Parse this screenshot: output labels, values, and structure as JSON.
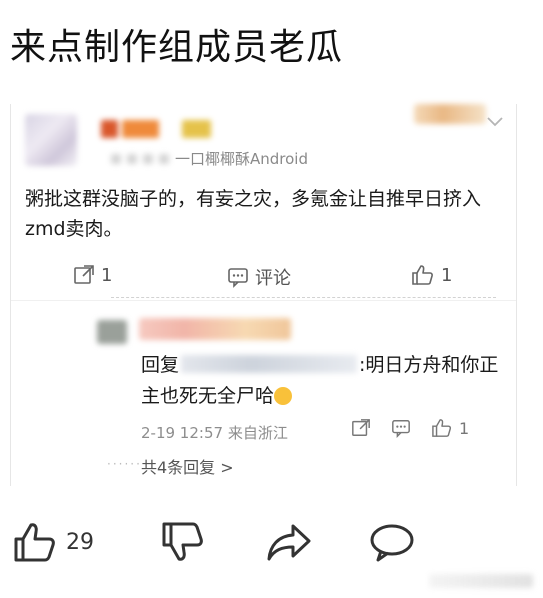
{
  "headline": "来点制作组成员老瓜",
  "post": {
    "source": "一口椰椰酥Android",
    "text": "粥批这群没脑子的，有妄之灾，多氪金让自推早日挤入zmd卖肉。",
    "repost_count": "1",
    "comment_label": "评论",
    "like_count": "1"
  },
  "reply": {
    "prefix": "回复",
    "suffix": ":明日方舟和你正主也死无全尸哈",
    "timestamp": "2-19 12:57",
    "location": "来自浙江",
    "like_count": "1",
    "more_replies": "共4条回复 >"
  },
  "bottom": {
    "like_count": "29"
  },
  "colors": {
    "text": "#1a1a1a",
    "meta": "#8a8a8a",
    "icon": "#333333",
    "emoji": "#f9c13a"
  },
  "icons": [
    "chevron-down-icon",
    "repost-icon",
    "comment-icon",
    "thumbs-up-icon",
    "share-icon",
    "thumbs-down-icon",
    "speech-bubble-icon"
  ]
}
